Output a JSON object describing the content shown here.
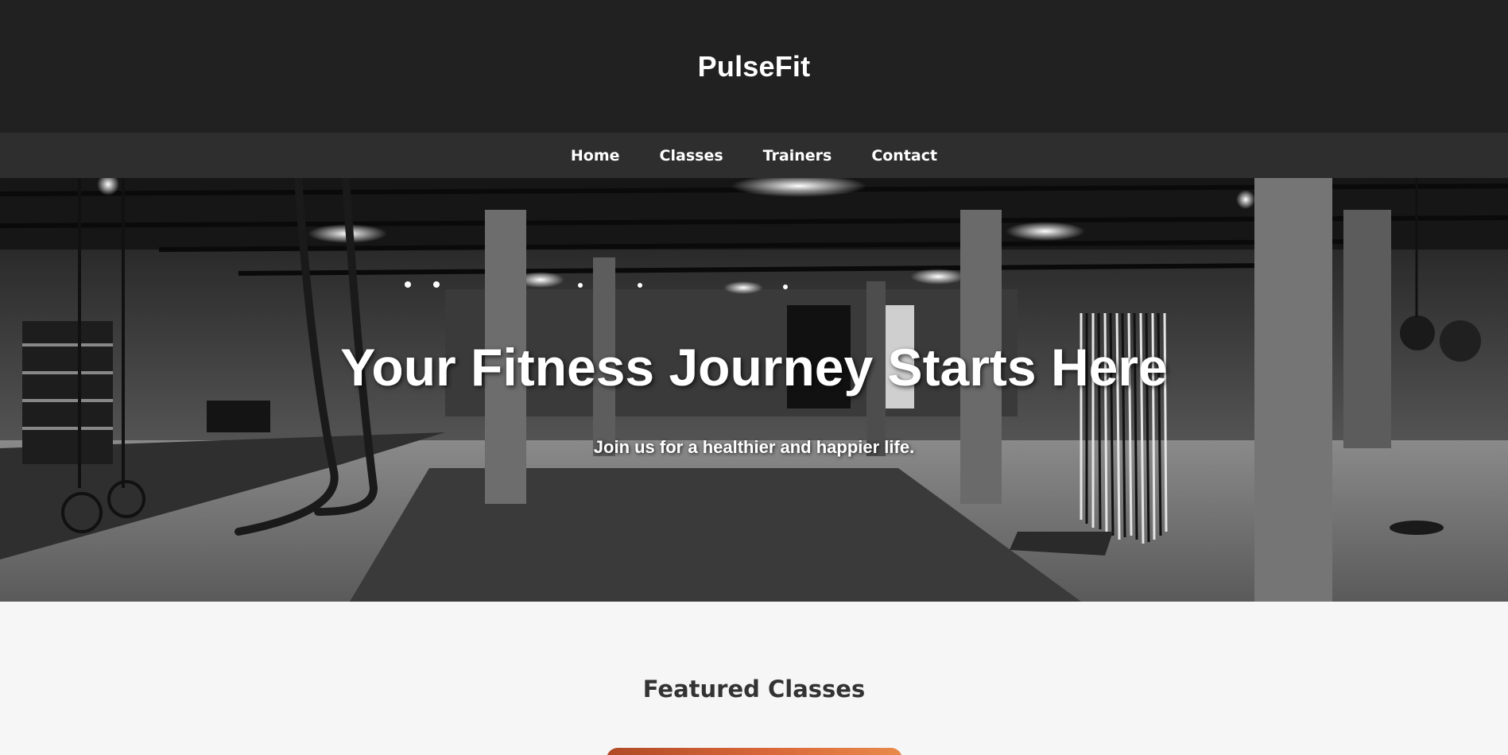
{
  "header": {
    "brand": "PulseFit"
  },
  "nav": {
    "items": [
      {
        "label": "Home"
      },
      {
        "label": "Classes"
      },
      {
        "label": "Trainers"
      },
      {
        "label": "Contact"
      }
    ]
  },
  "hero": {
    "title": "Your Fitness Journey Starts Here",
    "subtitle": "Join us for a healthier and happier life."
  },
  "featured": {
    "title": "Featured Classes"
  },
  "colors": {
    "header_bg": "#212121",
    "nav_bg": "#2e2e2e",
    "page_bg": "#f6f6f6",
    "card_accent": "#d9683a"
  }
}
